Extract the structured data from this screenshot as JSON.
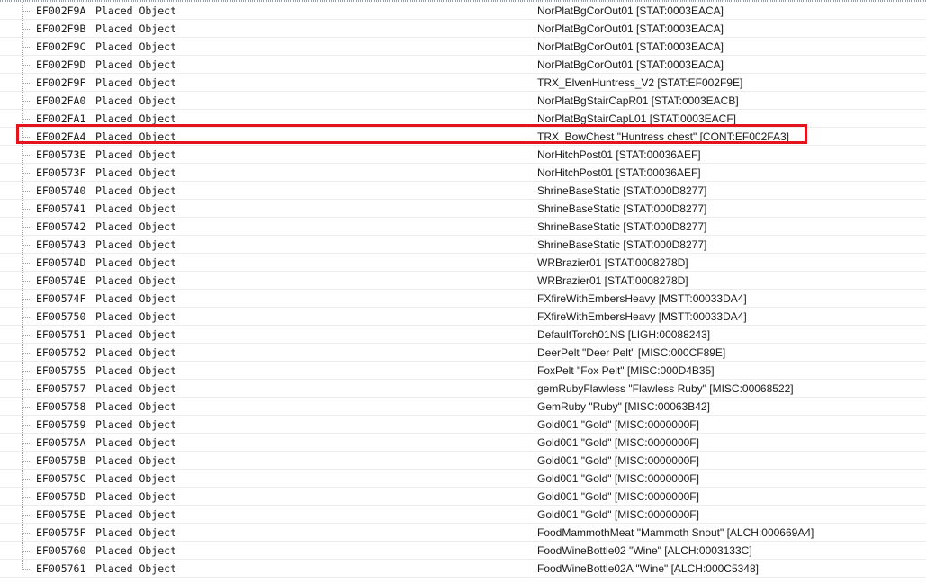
{
  "highlight": {
    "color": "#e3141d",
    "row_id": "EF002FA4"
  },
  "rows": [
    {
      "id": "EF002F9A",
      "type": "Placed Object",
      "value": "NorPlatBgCorOut01 [STAT:0003EACA]"
    },
    {
      "id": "EF002F9B",
      "type": "Placed Object",
      "value": "NorPlatBgCorOut01 [STAT:0003EACA]"
    },
    {
      "id": "EF002F9C",
      "type": "Placed Object",
      "value": "NorPlatBgCorOut01 [STAT:0003EACA]"
    },
    {
      "id": "EF002F9D",
      "type": "Placed Object",
      "value": "NorPlatBgCorOut01 [STAT:0003EACA]"
    },
    {
      "id": "EF002F9F",
      "type": "Placed Object",
      "value": "TRX_ElvenHuntress_V2 [STAT:EF002F9E]"
    },
    {
      "id": "EF002FA0",
      "type": "Placed Object",
      "value": "NorPlatBgStairCapR01 [STAT:0003EACB]"
    },
    {
      "id": "EF002FA1",
      "type": "Placed Object",
      "value": "NorPlatBgStairCapL01 [STAT:0003EACF]"
    },
    {
      "id": "EF002FA4",
      "type": "Placed Object",
      "value": "TRX_BowChest \"Huntress chest\" [CONT:EF002FA3]"
    },
    {
      "id": "EF00573E",
      "type": "Placed Object",
      "value": "NorHitchPost01 [STAT:00036AEF]"
    },
    {
      "id": "EF00573F",
      "type": "Placed Object",
      "value": "NorHitchPost01 [STAT:00036AEF]"
    },
    {
      "id": "EF005740",
      "type": "Placed Object",
      "value": "ShrineBaseStatic [STAT:000D8277]"
    },
    {
      "id": "EF005741",
      "type": "Placed Object",
      "value": "ShrineBaseStatic [STAT:000D8277]"
    },
    {
      "id": "EF005742",
      "type": "Placed Object",
      "value": "ShrineBaseStatic [STAT:000D8277]"
    },
    {
      "id": "EF005743",
      "type": "Placed Object",
      "value": "ShrineBaseStatic [STAT:000D8277]"
    },
    {
      "id": "EF00574D",
      "type": "Placed Object",
      "value": "WRBrazier01 [STAT:0008278D]"
    },
    {
      "id": "EF00574E",
      "type": "Placed Object",
      "value": "WRBrazier01 [STAT:0008278D]"
    },
    {
      "id": "EF00574F",
      "type": "Placed Object",
      "value": "FXfireWithEmbersHeavy [MSTT:00033DA4]"
    },
    {
      "id": "EF005750",
      "type": "Placed Object",
      "value": "FXfireWithEmbersHeavy [MSTT:00033DA4]"
    },
    {
      "id": "EF005751",
      "type": "Placed Object",
      "value": "DefaultTorch01NS [LIGH:00088243]"
    },
    {
      "id": "EF005752",
      "type": "Placed Object",
      "value": "DeerPelt \"Deer Pelt\" [MISC:000CF89E]"
    },
    {
      "id": "EF005755",
      "type": "Placed Object",
      "value": "FoxPelt \"Fox Pelt\" [MISC:000D4B35]"
    },
    {
      "id": "EF005757",
      "type": "Placed Object",
      "value": "gemRubyFlawless \"Flawless Ruby\" [MISC:00068522]"
    },
    {
      "id": "EF005758",
      "type": "Placed Object",
      "value": "GemRuby \"Ruby\" [MISC:00063B42]"
    },
    {
      "id": "EF005759",
      "type": "Placed Object",
      "value": "Gold001 \"Gold\" [MISC:0000000F]"
    },
    {
      "id": "EF00575A",
      "type": "Placed Object",
      "value": "Gold001 \"Gold\" [MISC:0000000F]"
    },
    {
      "id": "EF00575B",
      "type": "Placed Object",
      "value": "Gold001 \"Gold\" [MISC:0000000F]"
    },
    {
      "id": "EF00575C",
      "type": "Placed Object",
      "value": "Gold001 \"Gold\" [MISC:0000000F]"
    },
    {
      "id": "EF00575D",
      "type": "Placed Object",
      "value": "Gold001 \"Gold\" [MISC:0000000F]"
    },
    {
      "id": "EF00575E",
      "type": "Placed Object",
      "value": "Gold001 \"Gold\" [MISC:0000000F]"
    },
    {
      "id": "EF00575F",
      "type": "Placed Object",
      "value": "FoodMammothMeat \"Mammoth Snout\" [ALCH:000669A4]"
    },
    {
      "id": "EF005760",
      "type": "Placed Object",
      "value": "FoodWineBottle02 \"Wine\" [ALCH:0003133C]"
    },
    {
      "id": "EF005761",
      "type": "Placed Object",
      "value": "FoodWineBottle02A \"Wine\" [ALCH:000C5348]"
    }
  ]
}
